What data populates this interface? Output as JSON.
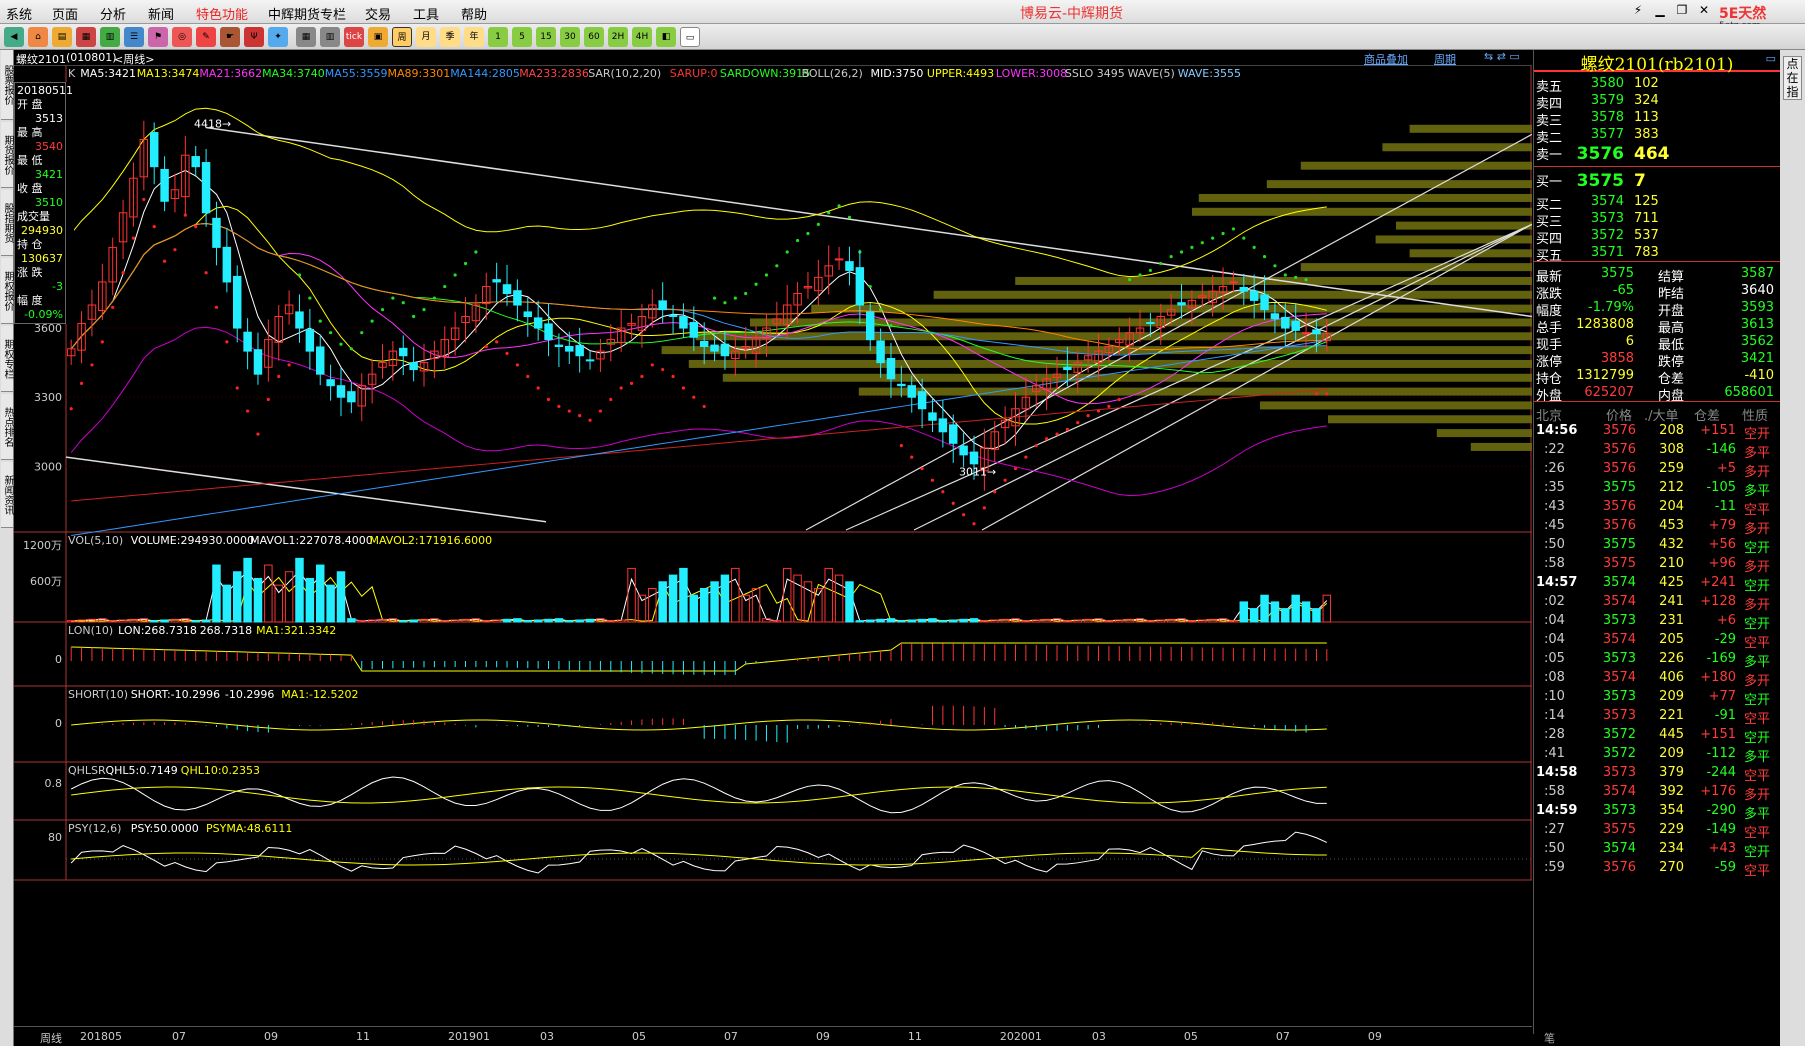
{
  "menu": [
    "系统",
    "页面",
    "分析",
    "新闻",
    "特色功能",
    "中辉期货专栏",
    "交易",
    "工具",
    "帮助"
  ],
  "app_title": "博易云-中辉期货",
  "logo_text": "5E天然",
  "logo_sub": "5etz.com",
  "toolbar": {
    "mi_xian": "tick",
    "w": "周",
    "m": "月",
    "j": "季",
    "n": "年",
    "nums": [
      "1",
      "5",
      "15",
      "30",
      "60",
      "2H",
      "4H"
    ]
  },
  "left_tabs": [
    "股票报价",
    "期货报价",
    "股指期货",
    "期权报价",
    "期权专栏",
    "热点排名",
    "新闻资讯"
  ],
  "chart_header": {
    "symbol": "螺纹2101",
    "code": "(010801)",
    "period": "<周线>",
    "link1": "商品叠加",
    "link2": "周期"
  },
  "info": {
    "date": "20180511",
    "open_label": "开 盘",
    "open": "3513",
    "high_label": "最 高",
    "high": "3540",
    "low_label": "最 低",
    "low": "3421",
    "close_label": "收 盘",
    "close": "3510",
    "vol_label": "成交量",
    "vol": "294930",
    "oi_label": "持 仓",
    "oi": "130637",
    "chg_label": "涨 跌",
    "chg": "-3",
    "pct_label": "幅 度",
    "pct": "-0.09%"
  },
  "indicators": {
    "k_line": [
      {
        "t": "K",
        "c": "#ccc"
      },
      {
        "t": "MA5:3421",
        "c": "#fff"
      },
      {
        "t": "MA13:3474",
        "c": "#ff0"
      },
      {
        "t": "MA21:3662",
        "c": "#f3f"
      },
      {
        "t": "MA34:3740",
        "c": "#2f2"
      },
      {
        "t": "MA55:3559",
        "c": "#39f"
      },
      {
        "t": "MA89:3301",
        "c": "#f80"
      },
      {
        "t": "MA144:2805",
        "c": "#39f"
      },
      {
        "t": "MA233:2836",
        "c": "#f44"
      },
      {
        "t": "SAR(10,2,20)",
        "c": "#ccc"
      },
      {
        "t": "SARUP:0",
        "c": "#f33"
      },
      {
        "t": "SARDOWN:3915",
        "c": "#2f2"
      },
      {
        "t": "BOLL(26,2)",
        "c": "#ccc"
      },
      {
        "t": "MID:3750",
        "c": "#fff"
      },
      {
        "t": "UPPER:4493",
        "c": "#ff0"
      },
      {
        "t": "LOWER:3008",
        "c": "#f3f"
      },
      {
        "t": "SSLO 3495",
        "c": "#ccc"
      },
      {
        "t": "WAVE(5)",
        "c": "#ccc"
      },
      {
        "t": "WAVE:3555",
        "c": "#8cf"
      }
    ],
    "vol_line": [
      {
        "t": "VOL(5,10)",
        "c": "#ccc"
      },
      {
        "t": "VOLUME:294930.0000",
        "c": "#fff"
      },
      {
        "t": "MAVOL1:227078.4000",
        "c": "#fff"
      },
      {
        "t": "MAVOL2:171916.6000",
        "c": "#ff0"
      }
    ],
    "lon_line": [
      {
        "t": "LON(10)",
        "c": "#ccc"
      },
      {
        "t": "LON:268.7318",
        "c": "#fff"
      },
      {
        "t": "268.7318",
        "c": "#fff"
      },
      {
        "t": "MA1:321.3342",
        "c": "#ff0"
      }
    ],
    "short_line": [
      {
        "t": "SHORT(10)",
        "c": "#ccc"
      },
      {
        "t": "SHORT:-10.2996",
        "c": "#fff"
      },
      {
        "t": "-10.2996",
        "c": "#fff"
      },
      {
        "t": "MA1:-12.5202",
        "c": "#ff0"
      }
    ],
    "qhl_line": [
      {
        "t": "QHLSR",
        "c": "#ccc"
      },
      {
        "t": "QHL5:0.7149",
        "c": "#fff"
      },
      {
        "t": "QHL10:0.2353",
        "c": "#ff0"
      }
    ],
    "psy_line": [
      {
        "t": "PSY(12,6)",
        "c": "#ccc"
      },
      {
        "t": "PSY:50.0000",
        "c": "#fff"
      },
      {
        "t": "PSYMA:48.6111",
        "c": "#ff0"
      }
    ]
  },
  "yaxis": {
    "main": [
      "3600",
      "3300",
      "3000"
    ],
    "vol": [
      "1200万",
      "600万"
    ],
    "lon": "0",
    "short": "0",
    "qhl": "0.8",
    "psy": "80"
  },
  "price_marks": {
    "high": "4418",
    "low": "3011"
  },
  "xaxis": {
    "label": "周线",
    "ticks": [
      "201805",
      "07",
      "09",
      "11",
      "201901",
      "03",
      "05",
      "07",
      "09",
      "11",
      "202001",
      "03",
      "05",
      "07",
      "09"
    ]
  },
  "quote": {
    "title": "螺纹2101(rb2101)",
    "sells": [
      {
        "l": "卖五",
        "p": "3580",
        "v": "102"
      },
      {
        "l": "卖四",
        "p": "3579",
        "v": "324"
      },
      {
        "l": "卖三",
        "p": "3578",
        "v": "113"
      },
      {
        "l": "卖二",
        "p": "3577",
        "v": "383"
      },
      {
        "l": "卖一",
        "p": "3576",
        "v": "464"
      }
    ],
    "buys": [
      {
        "l": "买一",
        "p": "3575",
        "v": "7"
      },
      {
        "l": "买二",
        "p": "3574",
        "v": "125"
      },
      {
        "l": "买三",
        "p": "3573",
        "v": "711"
      },
      {
        "l": "买四",
        "p": "3572",
        "v": "537"
      },
      {
        "l": "买五",
        "p": "3571",
        "v": "783"
      }
    ],
    "stats": [
      {
        "l1": "最新",
        "v1": "3575",
        "c1": "#21ff21",
        "l2": "结算",
        "v2": "3587",
        "c2": "#21ff21"
      },
      {
        "l1": "涨跌",
        "v1": "-65",
        "c1": "#21ff21",
        "l2": "昨结",
        "v2": "3640",
        "c2": "#fff"
      },
      {
        "l1": "幅度",
        "v1": "-1.79%",
        "c1": "#21ff21",
        "l2": "开盘",
        "v2": "3593",
        "c2": "#21ff21"
      },
      {
        "l1": "总手",
        "v1": "1283808",
        "c1": "#ffff33",
        "l2": "最高",
        "v2": "3613",
        "c2": "#21ff21"
      },
      {
        "l1": "现手",
        "v1": "6",
        "c1": "#ffff33",
        "l2": "最低",
        "v2": "3562",
        "c2": "#21ff21"
      },
      {
        "l1": "涨停",
        "v1": "3858",
        "c1": "#ff3b3b",
        "l2": "跌停",
        "v2": "3421",
        "c2": "#21ff21"
      },
      {
        "l1": "持仓",
        "v1": "1312799",
        "c1": "#ffff33",
        "l2": "仓差",
        "v2": "-410",
        "c2": "#ffff33"
      },
      {
        "l1": "外盘",
        "v1": "625207",
        "c1": "#ff3b3b",
        "l2": "内盘",
        "v2": "658601",
        "c2": "#21ff21"
      }
    ],
    "tick_header": {
      "time": "北京",
      "price": "价格",
      "vol": "./大单",
      "chg": "仓差",
      "nature": "性质"
    },
    "ticks": [
      {
        "t": "14:56",
        "p": "3576",
        "v": "208",
        "c": "+151",
        "n": "空开",
        "nc": "#ff3b3b"
      },
      {
        "t": ":22",
        "p": "3576",
        "v": "308",
        "c": "-146",
        "n": "多平",
        "nc": "#ff3b3b"
      },
      {
        "t": ":26",
        "p": "3576",
        "v": "259",
        "c": "+5",
        "n": "多开",
        "nc": "#ff3b3b"
      },
      {
        "t": ":35",
        "p": "3575",
        "v": "212",
        "c": "-105",
        "n": "多平",
        "nc": "#21ff21"
      },
      {
        "t": ":43",
        "p": "3576",
        "v": "204",
        "c": "-11",
        "n": "空平",
        "nc": "#ff3b3b"
      },
      {
        "t": ":45",
        "p": "3576",
        "v": "453",
        "c": "+79",
        "n": "多开",
        "nc": "#ff3b3b"
      },
      {
        "t": ":50",
        "p": "3575",
        "v": "432",
        "c": "+56",
        "n": "空开",
        "nc": "#21ff21"
      },
      {
        "t": ":58",
        "p": "3575",
        "v": "210",
        "c": "+96",
        "n": "多开",
        "nc": "#ff3b3b"
      },
      {
        "t": "14:57",
        "p": "3574",
        "v": "425",
        "c": "+241",
        "n": "空开",
        "nc": "#21ff21"
      },
      {
        "t": ":02",
        "p": "3574",
        "v": "241",
        "c": "+128",
        "n": "多开",
        "nc": "#ff3b3b"
      },
      {
        "t": ":04",
        "p": "3573",
        "v": "231",
        "c": "+6",
        "n": "空开",
        "nc": "#21ff21"
      },
      {
        "t": ":04",
        "p": "3574",
        "v": "205",
        "c": "-29",
        "n": "空平",
        "nc": "#ff3b3b"
      },
      {
        "t": ":05",
        "p": "3573",
        "v": "226",
        "c": "-169",
        "n": "多平",
        "nc": "#21ff21"
      },
      {
        "t": ":08",
        "p": "3574",
        "v": "406",
        "c": "+180",
        "n": "多开",
        "nc": "#ff3b3b"
      },
      {
        "t": ":10",
        "p": "3573",
        "v": "209",
        "c": "+77",
        "n": "空开",
        "nc": "#21ff21"
      },
      {
        "t": ":14",
        "p": "3573",
        "v": "221",
        "c": "-91",
        "n": "空平",
        "nc": "#ff3b3b"
      },
      {
        "t": ":28",
        "p": "3572",
        "v": "445",
        "c": "+151",
        "n": "空开",
        "nc": "#21ff21"
      },
      {
        "t": ":41",
        "p": "3572",
        "v": "209",
        "c": "-112",
        "n": "多平",
        "nc": "#21ff21"
      },
      {
        "t": "14:58",
        "p": "3573",
        "v": "379",
        "c": "-244",
        "n": "空平",
        "nc": "#ff3b3b"
      },
      {
        "t": ":58",
        "p": "3574",
        "v": "392",
        "c": "+176",
        "n": "多开",
        "nc": "#ff3b3b"
      },
      {
        "t": "14:59",
        "p": "3573",
        "v": "354",
        "c": "-290",
        "n": "多平",
        "nc": "#21ff21"
      },
      {
        "t": ":27",
        "p": "3575",
        "v": "229",
        "c": "-149",
        "n": "空平",
        "nc": "#ff3b3b"
      },
      {
        "t": ":50",
        "p": "3574",
        "v": "234",
        "c": "+43",
        "n": "空开",
        "nc": "#21ff21"
      },
      {
        "t": ":59",
        "p": "3576",
        "v": "270",
        "c": "-59",
        "n": "空平",
        "nc": "#ff3b3b"
      }
    ],
    "footer": "笔"
  },
  "right_tabs": [
    "点",
    "在",
    "指"
  ]
}
